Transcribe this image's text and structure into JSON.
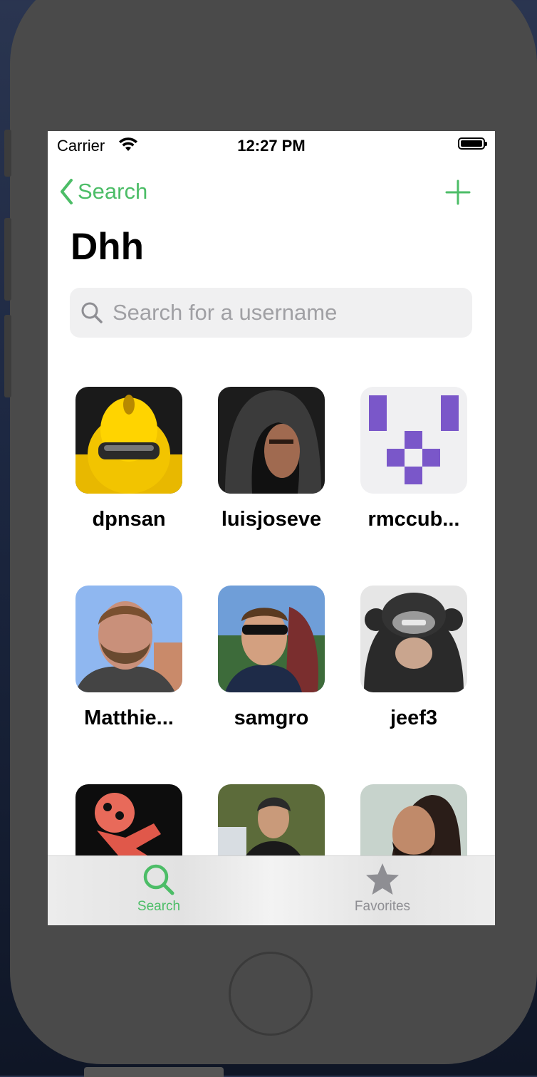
{
  "statusbar": {
    "carrier": "Carrier",
    "time": "12:27 PM"
  },
  "nav": {
    "back_label": "Search",
    "add_icon": "plus-icon"
  },
  "page": {
    "title": "Dhh"
  },
  "search": {
    "placeholder": "Search for a username",
    "value": ""
  },
  "users": [
    {
      "name": "dpnsan"
    },
    {
      "name": "luisjoseve"
    },
    {
      "name": "rmccub..."
    },
    {
      "name": "Matthie..."
    },
    {
      "name": "samgro"
    },
    {
      "name": "jeef3"
    },
    {
      "name": ""
    },
    {
      "name": ""
    },
    {
      "name": ""
    }
  ],
  "tabbar": {
    "tabs": [
      {
        "label": "Search",
        "icon": "search-icon",
        "selected": true
      },
      {
        "label": "Favorites",
        "icon": "star-icon",
        "selected": false
      }
    ]
  },
  "colors": {
    "accent": "#4cbd67",
    "inactive": "#8e8e93",
    "identicon": "#7a57c9"
  }
}
